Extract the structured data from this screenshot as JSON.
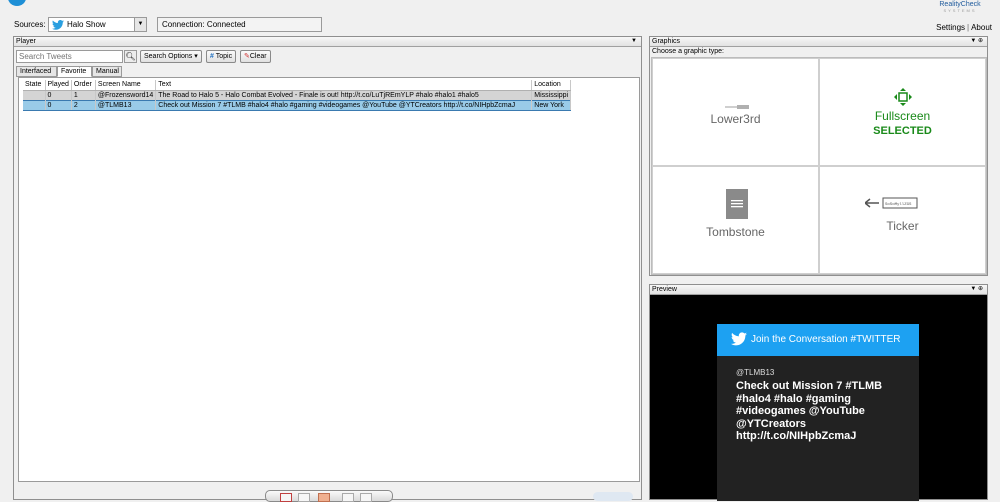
{
  "header": {
    "sources_label": "Sources:",
    "source_selected": "Halo Show",
    "connection_status": "Connection: Connected",
    "logo_line1": "RealityCheck",
    "logo_line2": "SYSTEMS",
    "settings_label": "Settings",
    "about_label": "About"
  },
  "player": {
    "title": "Player",
    "search_placeholder": "Search Tweets",
    "search_options_label": "Search Options ▾",
    "topic_label": "Topic",
    "clear_label": "Clear",
    "tabs": [
      {
        "label": "Interfaced"
      },
      {
        "label": "Favorite"
      },
      {
        "label": "Manual"
      }
    ],
    "active_tab": "Favorite",
    "columns": [
      "State",
      "Played",
      "Order",
      "Screen Name",
      "Text",
      "Location"
    ],
    "rows": [
      {
        "state": "",
        "played": "0",
        "order": "1",
        "screen_name": "@Frozensword14",
        "text": "The Road to Halo 5 - Halo Combat Evolved - Finale is out!  http://t.co/LuTjREmYLP  #halo #halo1 #halo5",
        "location": "Mississippi"
      },
      {
        "state": "",
        "played": "0",
        "order": "2",
        "screen_name": "@TLMB13",
        "text": "Check out Mission 7 #TLMB #halo4 #halo #gaming #videogames @YouTube @YTCreators http://t.co/NIHpbZcmaJ",
        "location": "New York"
      }
    ]
  },
  "graphics": {
    "title": "Graphics",
    "choose_label": "Choose a graphic type:",
    "types": [
      {
        "label": "Lower3rd",
        "icon": "lower3rd-icon",
        "selected": false
      },
      {
        "label": "Fullscreen",
        "icon": "move-arrows-icon",
        "selected": true
      },
      {
        "label": "Tombstone",
        "icon": "document-icon",
        "selected": false
      },
      {
        "label": "Ticker",
        "icon": "ticker-icon",
        "selected": false
      }
    ],
    "selected_text": "SELECTED",
    "ticker_icon_text": "SoSoMyllZGS"
  },
  "preview": {
    "title": "Preview",
    "card_header": "Join the Conversation #TWITTER",
    "card_user": "@TLMB13",
    "card_text": "Check out Mission 7 #TLMB #halo4 #halo #gaming #videogames @YouTube @YTCreators http://t.co/NIHpbZcmaJ"
  },
  "colors": {
    "twitter_blue": "#1da1f2",
    "selected_green": "#1a8a1a",
    "selected_row": "#99cbe8"
  }
}
